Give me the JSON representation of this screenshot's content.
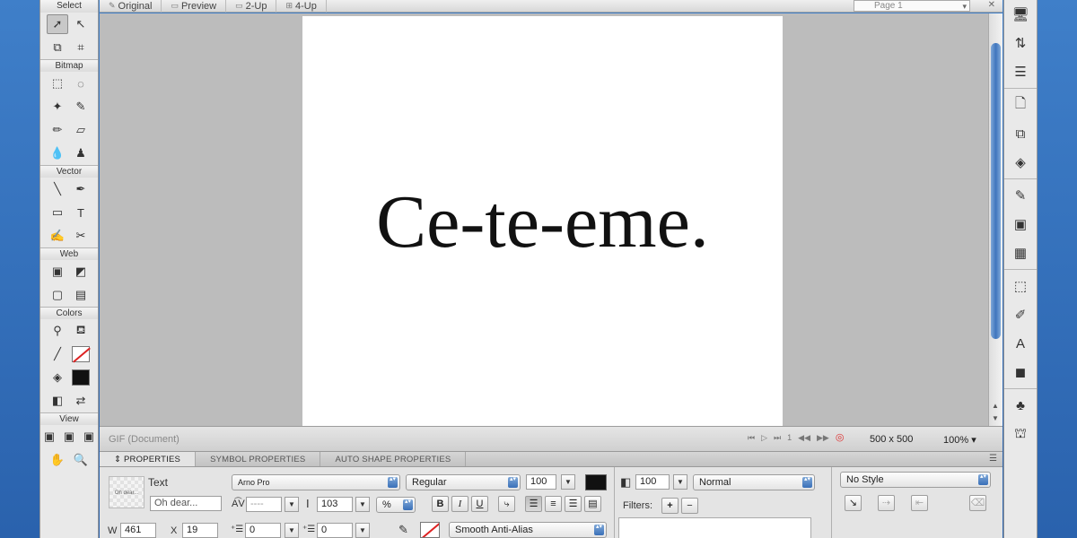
{
  "tools": {
    "sections": [
      {
        "label": "Select",
        "rows": [
          [
            {
              "name": "pointer-tool-icon",
              "glyph": "➚",
              "selected": true
            },
            {
              "name": "subselect-tool-icon",
              "glyph": "↖"
            }
          ],
          [
            {
              "name": "scale-tool-icon",
              "glyph": "⧉"
            },
            {
              "name": "crop-tool-icon",
              "glyph": "⌗"
            }
          ]
        ]
      },
      {
        "label": "Bitmap",
        "rows": [
          [
            {
              "name": "marquee-tool-icon",
              "glyph": "⬚"
            },
            {
              "name": "lasso-tool-icon",
              "glyph": "◌"
            }
          ],
          [
            {
              "name": "magic-wand-tool-icon",
              "glyph": "✦"
            },
            {
              "name": "brush-tool-icon",
              "glyph": "✎"
            }
          ],
          [
            {
              "name": "pencil-tool-icon",
              "glyph": "✏"
            },
            {
              "name": "eraser-tool-icon",
              "glyph": "▱"
            }
          ],
          [
            {
              "name": "blur-tool-icon",
              "glyph": "💧"
            },
            {
              "name": "rubber-stamp-tool-icon",
              "glyph": "♟"
            }
          ]
        ]
      },
      {
        "label": "Vector",
        "rows": [
          [
            {
              "name": "line-tool-icon",
              "glyph": "╲"
            },
            {
              "name": "pen-tool-icon",
              "glyph": "✒"
            }
          ],
          [
            {
              "name": "rectangle-tool-icon",
              "glyph": "▭"
            },
            {
              "name": "text-tool-icon",
              "glyph": "T"
            }
          ],
          [
            {
              "name": "freeform-tool-icon",
              "glyph": "✍"
            },
            {
              "name": "knife-tool-icon",
              "glyph": "✂"
            }
          ]
        ]
      },
      {
        "label": "Web",
        "rows": [
          [
            {
              "name": "hotspot-tool-icon",
              "glyph": "▣"
            },
            {
              "name": "slice-tool-icon",
              "glyph": "◩"
            }
          ],
          [
            {
              "name": "hide-slices-icon",
              "glyph": "▢"
            },
            {
              "name": "show-slices-icon",
              "glyph": "▤"
            }
          ]
        ]
      },
      {
        "label": "Colors",
        "rows": [
          [
            {
              "name": "eyedropper-tool-icon",
              "glyph": "⚲"
            },
            {
              "name": "paint-bucket-tool-icon",
              "glyph": "⛾"
            }
          ],
          [
            {
              "name": "stroke-pencil-icon",
              "glyph": "╱"
            },
            {
              "name": "stroke-color-swatch",
              "glyph": "",
              "type": "stroke"
            }
          ],
          [
            {
              "name": "fill-bucket-icon",
              "glyph": "◈"
            },
            {
              "name": "fill-color-swatch",
              "glyph": "",
              "type": "fill"
            }
          ],
          [
            {
              "name": "default-colors-icon",
              "glyph": "◧"
            },
            {
              "name": "swap-colors-icon",
              "glyph": "⇄"
            }
          ]
        ]
      },
      {
        "label": "View",
        "rows": [
          [
            {
              "name": "standard-screen-icon",
              "glyph": "▣"
            },
            {
              "name": "full-screen-menu-icon",
              "glyph": "▣"
            },
            {
              "name": "full-screen-icon",
              "glyph": "▣"
            }
          ],
          [
            {
              "name": "hand-tool-icon",
              "glyph": "✋"
            },
            {
              "name": "zoom-tool-icon",
              "glyph": "🔍"
            }
          ]
        ]
      }
    ]
  },
  "doc_tabs": [
    {
      "label": "Original",
      "icon": "pencil-icon",
      "glyph": "✎"
    },
    {
      "label": "Preview",
      "icon": "preview-icon",
      "glyph": "▭"
    },
    {
      "label": "2-Up",
      "icon": "two-up-icon",
      "glyph": "▭"
    },
    {
      "label": "4-Up",
      "icon": "four-up-icon",
      "glyph": "⊞"
    }
  ],
  "page_selector": {
    "value": "Page 1"
  },
  "canvas": {
    "text": "Ce-te-eme."
  },
  "status": {
    "document": "GIF (Document)",
    "size": "500 x 500",
    "zoom": "100%"
  },
  "properties": {
    "tabs": [
      "PROPERTIES",
      "SYMBOL PROPERTIES",
      "AUTO SHAPE PROPERTIES"
    ],
    "object_type": "Text",
    "object_name": "Oh dear...",
    "thumb_text": "Oh dear...",
    "font": "Arno Pro",
    "style": "Regular",
    "size": "100",
    "kerning": "----",
    "leading": "103",
    "leading_unit": "%",
    "bold": "B",
    "italic": "I",
    "underline": "U",
    "opacity": "100",
    "blend_mode": "Normal",
    "filters_label": "Filters:",
    "filter_add": "+",
    "filter_remove": "−",
    "style_select": "No Style",
    "w_label": "W",
    "w_value": "461",
    "x_label": "X",
    "x_value": "19",
    "indent": "0",
    "space_before": "0",
    "anti_alias": "Smooth Anti-Alias"
  },
  "right_tools": [
    [
      "monitor-icon",
      "transfer-icon",
      "stack-icon"
    ],
    [
      "new-page-icon",
      "duplicate-page-icon",
      "layers-icon"
    ],
    [
      "image-editor-icon",
      "image-icon",
      "frames-icon"
    ],
    [
      "transform-icon",
      "path-icon",
      "align-icon",
      "cube-icon"
    ],
    [
      "behaviors-icon",
      "library-icon"
    ]
  ],
  "colors": {
    "accent": "#3e75bd",
    "desktop": "#3f7fc9",
    "stroke_red": "#dd2222",
    "fill": "#111111"
  }
}
